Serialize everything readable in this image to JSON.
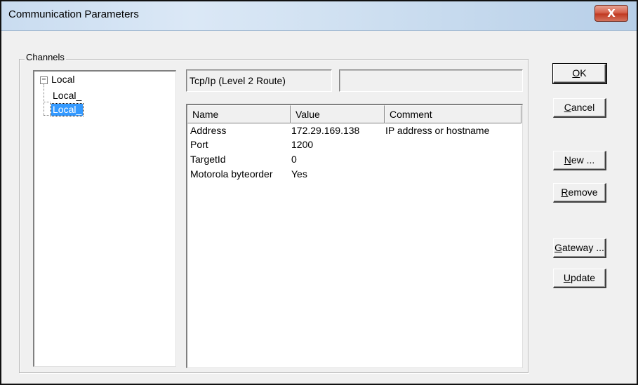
{
  "window": {
    "title": "Communication Parameters",
    "close_glyph": "X"
  },
  "channels": {
    "group_label": "Channels",
    "tree": [
      {
        "label": "Local",
        "level": 0,
        "expanded": true,
        "selected": false
      },
      {
        "label": "Local_",
        "level": 1,
        "selected": false
      },
      {
        "label": "Local_",
        "level": 1,
        "selected": true
      }
    ],
    "driver_name": "Tcp/Ip (Level 2 Route)",
    "driver_info": ""
  },
  "parameters": {
    "columns": [
      "Name",
      "Value",
      "Comment"
    ],
    "rows": [
      {
        "name": "Address",
        "value": "172.29.169.138",
        "comment": "IP address or hostname"
      },
      {
        "name": "Port",
        "value": "1200",
        "comment": ""
      },
      {
        "name": "TargetId",
        "value": "0",
        "comment": ""
      },
      {
        "name": "Motorola byteorder",
        "value": "Yes",
        "comment": ""
      }
    ]
  },
  "buttons": {
    "ok": {
      "mnemonic": "O",
      "rest": "K"
    },
    "cancel": {
      "mnemonic": "C",
      "rest": "ancel"
    },
    "new": {
      "mnemonic": "N",
      "rest": "ew ..."
    },
    "remove": {
      "mnemonic": "R",
      "rest": "emove"
    },
    "gateway": {
      "mnemonic": "G",
      "rest": "ateway ..."
    },
    "update": {
      "mnemonic": "U",
      "rest": "pdate"
    }
  },
  "colors": {
    "selection": "#3399ff",
    "dialog_face": "#f0f0f0",
    "close_button": "#c13a22"
  }
}
